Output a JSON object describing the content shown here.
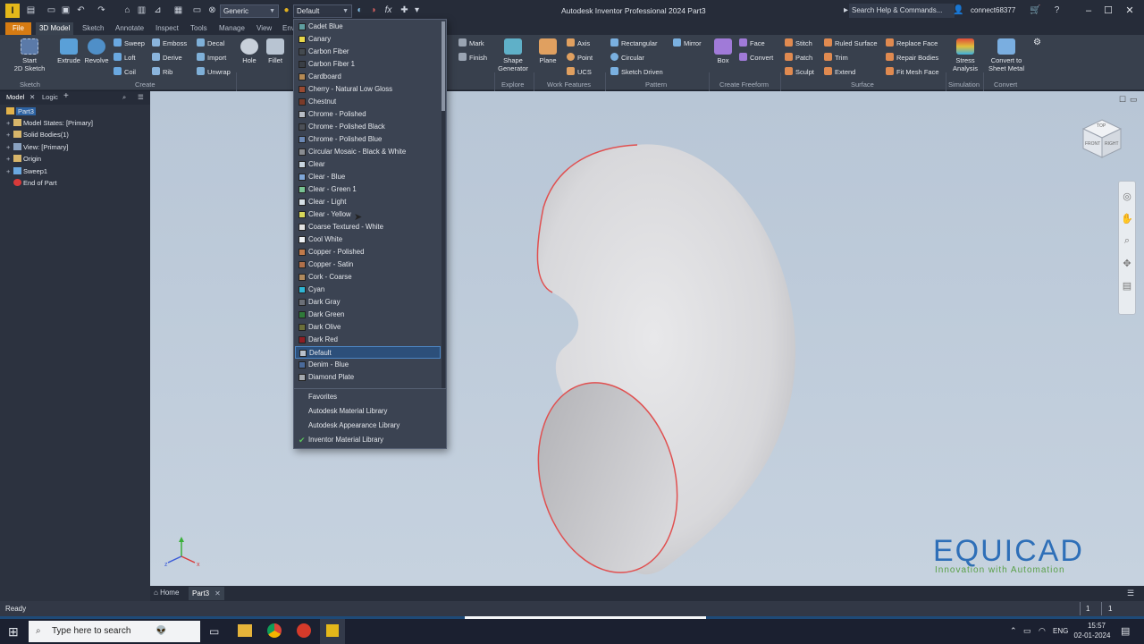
{
  "window_title": "Autodesk Inventor Professional 2024   Part3",
  "qat": {
    "appearance_combo": "Generic",
    "material_combo": "Default",
    "help_search": "Search Help & Commands...",
    "user": "connect68377"
  },
  "tabs": [
    "File",
    "3D Model",
    "Sketch",
    "Annotate",
    "Inspect",
    "Tools",
    "Manage",
    "View",
    "Env"
  ],
  "ribbon": {
    "start_sketch": "Start\n2D Sketch",
    "extrude": "Extrude",
    "revolve": "Revolve",
    "sweep": "Sweep",
    "loft": "Loft",
    "coil": "Coil",
    "emboss": "Emboss",
    "derive": "Derive",
    "rib": "Rib",
    "decal": "Decal",
    "import": "Import",
    "unwrap": "Unwrap",
    "hole": "Hole",
    "fillet": "Fillet",
    "mark": "Mark",
    "finish": "Finish",
    "shape_generator": "Shape\nGenerator",
    "plane": "Plane",
    "axis": "Axis",
    "point": "Point",
    "ucs": "UCS",
    "rectangular": "Rectangular",
    "circular": "Circular",
    "sketch_driven": "Sketch Driven",
    "mirror": "Mirror",
    "box": "Box",
    "face": "Face",
    "convert": "Convert",
    "stitch": "Stitch",
    "patch": "Patch",
    "sculpt": "Sculpt",
    "ruled_surface": "Ruled Surface",
    "trim": "Trim",
    "extend": "Extend",
    "replace_face": "Replace Face",
    "repair_bodies": "Repair Bodies",
    "fit_mesh_face": "Fit Mesh Face",
    "stress_analysis": "Stress\nAnalysis",
    "convert_sheet_metal": "Convert to\nSheet Metal",
    "panels": {
      "sketch": "Sketch",
      "create": "Create",
      "explore": "Explore",
      "work_features": "Work Features",
      "pattern": "Pattern",
      "freeform": "Create Freeform",
      "surface": "Surface",
      "simulation": "Simulation",
      "convert": "Convert"
    }
  },
  "browser": {
    "tabs": [
      "Model",
      "Logic"
    ],
    "tree": [
      "Part3",
      "Model States: [Primary]",
      "Solid Bodies(1)",
      "View: [Primary]",
      "Origin",
      "Sweep1",
      "End of Part"
    ]
  },
  "dropdown": {
    "items": [
      {
        "label": "Cadet Blue",
        "color": "#5f9ea0"
      },
      {
        "label": "Canary",
        "color": "#e8d84a"
      },
      {
        "label": "Carbon Fiber",
        "color": "#444a50"
      },
      {
        "label": "Carbon Fiber 1",
        "color": "#3a3f46"
      },
      {
        "label": "Cardboard",
        "color": "#b58a55"
      },
      {
        "label": "Cherry - Natural Low Gloss",
        "color": "#9a4a32"
      },
      {
        "label": "Chestnut",
        "color": "#7b3b2a"
      },
      {
        "label": "Chrome - Polished",
        "color": "#b9bec6"
      },
      {
        "label": "Chrome - Polished Black",
        "color": "#4c5058"
      },
      {
        "label": "Chrome - Polished Blue",
        "color": "#6c89b6"
      },
      {
        "label": "Circular Mosaic - Black & White",
        "color": "#8a8d92"
      },
      {
        "label": "Clear",
        "color": "#c9d6e0"
      },
      {
        "label": "Clear - Blue",
        "color": "#7ea6d8"
      },
      {
        "label": "Clear - Green 1",
        "color": "#79c494"
      },
      {
        "label": "Clear - Light",
        "color": "#d6e0e6"
      },
      {
        "label": "Clear - Yellow",
        "color": "#d8d85a"
      },
      {
        "label": "Coarse Textured - White",
        "color": "#e2e2e2"
      },
      {
        "label": "Cool White",
        "color": "#eef2f6"
      },
      {
        "label": "Copper - Polished",
        "color": "#c17a4a"
      },
      {
        "label": "Copper - Satin",
        "color": "#b0704a"
      },
      {
        "label": "Cork - Coarse",
        "color": "#b08a5e"
      },
      {
        "label": "Cyan",
        "color": "#2fb6d6"
      },
      {
        "label": "Dark Gray",
        "color": "#6c7078"
      },
      {
        "label": "Dark Green",
        "color": "#2f7a3a"
      },
      {
        "label": "Dark Olive",
        "color": "#6b6f3a"
      },
      {
        "label": "Dark Red",
        "color": "#8e1e24"
      },
      {
        "label": "Default",
        "color": "#b9c1cb",
        "selected": true
      },
      {
        "label": "Denim - Blue",
        "color": "#4a6a9a"
      },
      {
        "label": "Diamond Plate",
        "color": "#a3a8ae"
      }
    ],
    "libraries": [
      "Favorites",
      "Autodesk Material Library",
      "Autodesk Appearance Library",
      "Inventor Material Library"
    ],
    "active_library": "Inventor Material Library"
  },
  "viewcube": {
    "top": "TOP",
    "front": "FRONT",
    "right": "RIGHT"
  },
  "watermark": {
    "brand": "EQUICAD",
    "tagline": "Innovation with Automation"
  },
  "doc_tabs": {
    "home": "Home",
    "part": "Part3"
  },
  "status": {
    "text": "Ready",
    "count1": "1",
    "count2": "1"
  },
  "taskbar": {
    "search_placeholder": "Type here to search",
    "lang": "ENG",
    "time": "15:57",
    "date": "02-01-2024"
  }
}
